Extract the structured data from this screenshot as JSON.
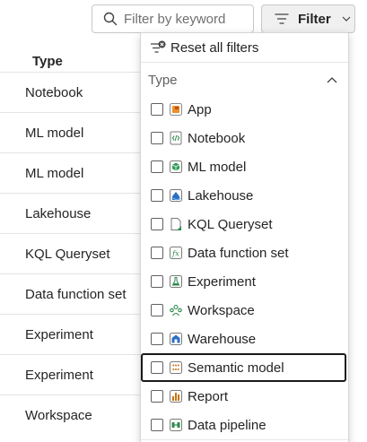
{
  "search": {
    "placeholder": "Filter by keyword"
  },
  "filter_button": {
    "label": "Filter"
  },
  "table": {
    "column_header": "Type",
    "rows": [
      "Notebook",
      "ML model",
      "ML model",
      "Lakehouse",
      "KQL Queryset",
      "Data function set",
      "Experiment",
      "Experiment",
      "Workspace"
    ]
  },
  "dropdown": {
    "reset_label": "Reset all filters",
    "section_label": "Type",
    "options": [
      {
        "label": "App",
        "icon": "app-icon",
        "checked": false
      },
      {
        "label": "Notebook",
        "icon": "notebook-icon",
        "checked": false
      },
      {
        "label": "ML model",
        "icon": "ml-model-icon",
        "checked": false
      },
      {
        "label": "Lakehouse",
        "icon": "lakehouse-icon",
        "checked": false
      },
      {
        "label": "KQL Queryset",
        "icon": "kql-queryset-icon",
        "checked": false
      },
      {
        "label": "Data function set",
        "icon": "data-function-icon",
        "checked": false
      },
      {
        "label": "Experiment",
        "icon": "experiment-icon",
        "checked": false
      },
      {
        "label": "Workspace",
        "icon": "workspace-icon",
        "checked": false
      },
      {
        "label": "Warehouse",
        "icon": "warehouse-icon",
        "checked": false
      },
      {
        "label": "Semantic model",
        "icon": "semantic-model-icon",
        "checked": false,
        "focused": true
      },
      {
        "label": "Report",
        "icon": "report-icon",
        "checked": false
      },
      {
        "label": "Data pipeline",
        "icon": "data-pipeline-icon",
        "checked": false
      }
    ]
  }
}
